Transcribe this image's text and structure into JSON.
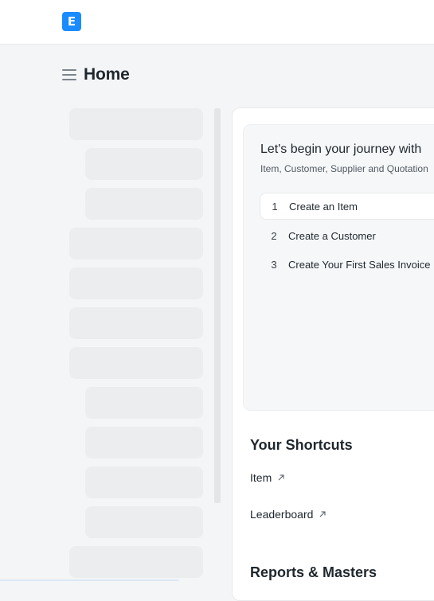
{
  "app": {
    "logo_letter": "E",
    "accent": "#1a8cff"
  },
  "header": {
    "title": "Home"
  },
  "onboarding": {
    "title": "Let's begin your journey with",
    "subtitle": "Item, Customer, Supplier and Quotation",
    "steps": [
      {
        "num": "1",
        "label": "Create an Item"
      },
      {
        "num": "2",
        "label": "Create a Customer"
      },
      {
        "num": "3",
        "label": "Create Your First Sales Invoice"
      }
    ]
  },
  "shortcuts": {
    "title": "Your Shortcuts",
    "items": [
      {
        "label": "Item"
      },
      {
        "label": "Leaderboard"
      }
    ]
  },
  "reports": {
    "title": "Reports & Masters"
  }
}
